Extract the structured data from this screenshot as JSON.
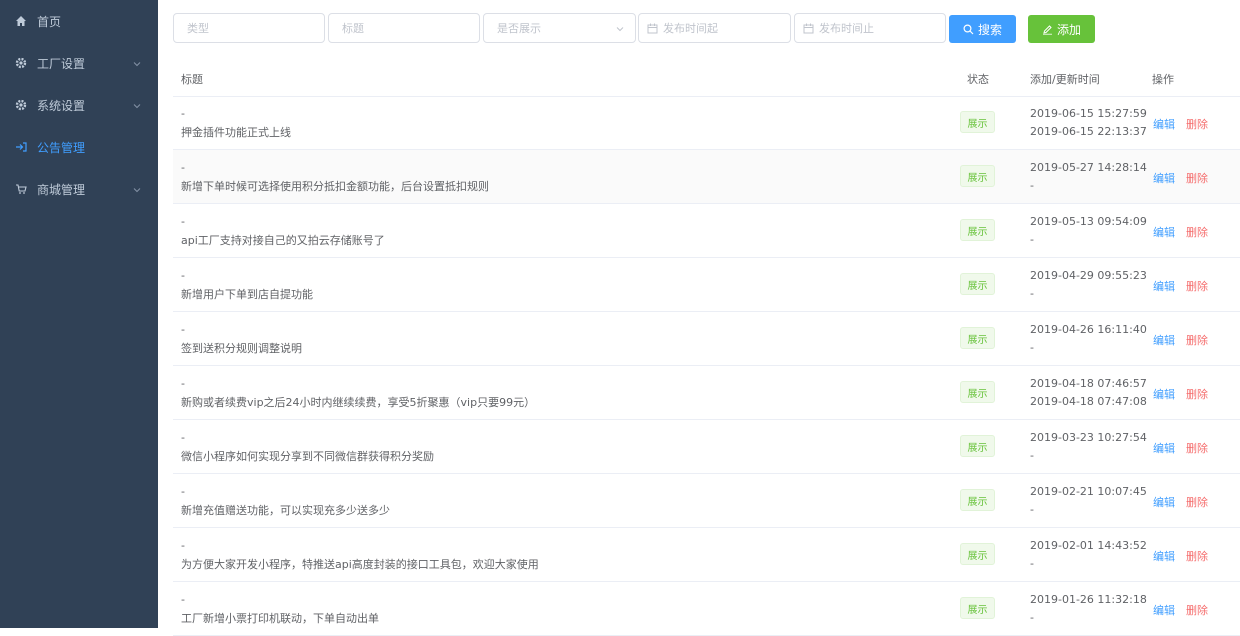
{
  "sidebar": {
    "items": [
      {
        "label": "首页",
        "icon": "home-icon"
      },
      {
        "label": "工厂设置",
        "icon": "gear-icon"
      },
      {
        "label": "系统设置",
        "icon": "gear-icon"
      },
      {
        "label": "公告管理",
        "icon": "announcement-icon"
      },
      {
        "label": "商城管理",
        "icon": "cart-icon"
      }
    ],
    "active_color": "#409eff",
    "bg_color": "#304156"
  },
  "filters": {
    "type_placeholder": "类型",
    "title_placeholder": "标题",
    "show_placeholder": "是否展示",
    "date_start_placeholder": "发布时间起",
    "date_end_placeholder": "发布时间止",
    "search_label": "搜索",
    "add_label": "添加"
  },
  "table": {
    "headers": {
      "title": "标题",
      "status": "状态",
      "time": "添加/更新时间",
      "ops": "操作"
    },
    "edit_label": "编辑",
    "delete_label": "删除",
    "rows": [
      {
        "prefix": "-",
        "title": "押金插件功能正式上线",
        "status": "展示",
        "added": "2019-06-15 15:27:59",
        "updated": "2019-06-15 22:13:37"
      },
      {
        "prefix": "-",
        "title": "新增下单时候可选择使用积分抵扣金额功能，后台设置抵扣规则",
        "status": "展示",
        "added": "2019-05-27 14:28:14",
        "updated": "-"
      },
      {
        "prefix": "-",
        "title": "api工厂支持对接自己的又拍云存储账号了",
        "status": "展示",
        "added": "2019-05-13 09:54:09",
        "updated": "-"
      },
      {
        "prefix": "-",
        "title": "新增用户下单到店自提功能",
        "status": "展示",
        "added": "2019-04-29 09:55:23",
        "updated": "-"
      },
      {
        "prefix": "-",
        "title": "签到送积分规则调整说明",
        "status": "展示",
        "added": "2019-04-26 16:11:40",
        "updated": "-"
      },
      {
        "prefix": "-",
        "title": "新购或者续费vip之后24小时内继续续费，享受5折聚惠（vip只要99元）",
        "status": "展示",
        "added": "2019-04-18 07:46:57",
        "updated": "2019-04-18 07:47:08"
      },
      {
        "prefix": "-",
        "title": "微信小程序如何实现分享到不同微信群获得积分奖励",
        "status": "展示",
        "added": "2019-03-23 10:27:54",
        "updated": "-"
      },
      {
        "prefix": "-",
        "title": "新增充值赠送功能，可以实现充多少送多少",
        "status": "展示",
        "added": "2019-02-21 10:07:45",
        "updated": "-"
      },
      {
        "prefix": "-",
        "title": "为方便大家开发小程序，特推送api高度封装的接口工具包，欢迎大家使用",
        "status": "展示",
        "added": "2019-02-01 14:43:52",
        "updated": "-"
      },
      {
        "prefix": "-",
        "title": "工厂新增小票打印机联动，下单自动出单",
        "status": "展示",
        "added": "2019-01-26 11:32:18",
        "updated": "-"
      }
    ]
  }
}
